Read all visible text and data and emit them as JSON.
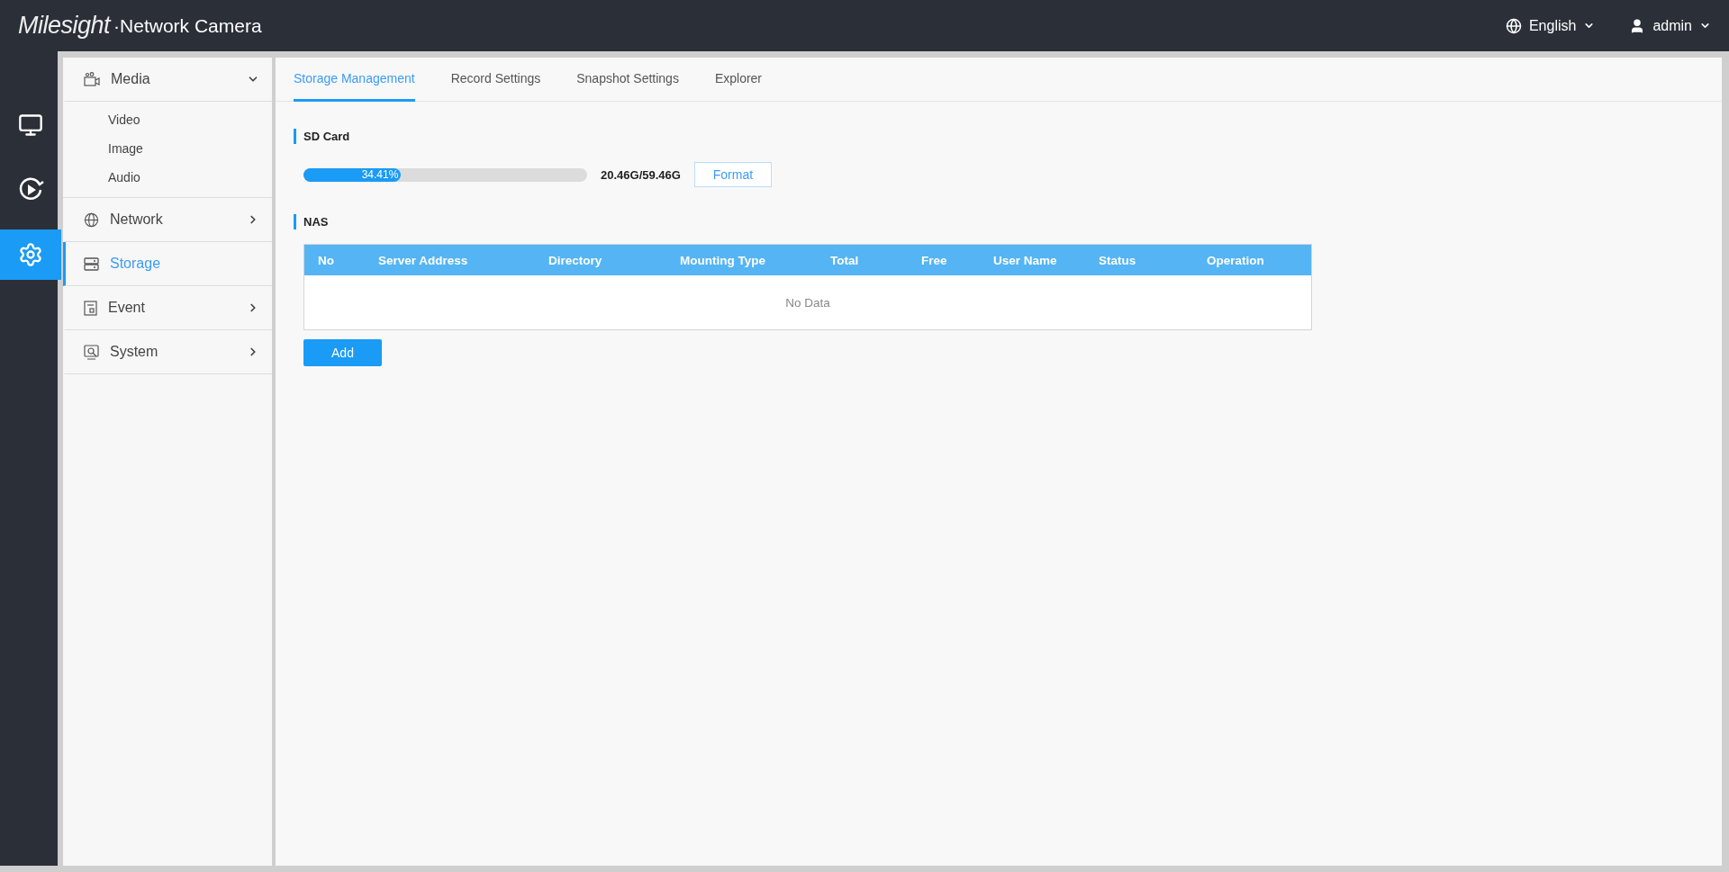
{
  "header": {
    "logo": "Milesight",
    "product": "·Network Camera",
    "language": "English",
    "user": "admin"
  },
  "rail": [
    {
      "kind": "live",
      "selected": false
    },
    {
      "kind": "playback",
      "selected": false
    },
    {
      "kind": "settings",
      "selected": true
    }
  ],
  "sidebar": {
    "items": [
      {
        "label": "Media",
        "kind": "media",
        "expanded": true,
        "selected": false,
        "children": [
          {
            "label": "Video"
          },
          {
            "label": "Image"
          },
          {
            "label": "Audio"
          }
        ]
      },
      {
        "label": "Network",
        "kind": "network",
        "expanded": false,
        "selected": false
      },
      {
        "label": "Storage",
        "kind": "storage",
        "expanded": false,
        "selected": true
      },
      {
        "label": "Event",
        "kind": "event",
        "expanded": false,
        "selected": false
      },
      {
        "label": "System",
        "kind": "system",
        "expanded": false,
        "selected": false
      }
    ]
  },
  "tabs": [
    {
      "label": "Storage Management",
      "selected": true
    },
    {
      "label": "Record Settings",
      "selected": false
    },
    {
      "label": "Snapshot Settings",
      "selected": false
    },
    {
      "label": "Explorer",
      "selected": false
    }
  ],
  "sd_card": {
    "title": "SD Card",
    "level": 0.3441,
    "percent": "34.41%",
    "capacity": "20.46G/59.46G",
    "format_button": "Format"
  },
  "nas": {
    "title": "NAS",
    "table": {
      "columns": [
        "No",
        "Server Address",
        "Directory",
        "Mounting Type",
        "Total",
        "Free",
        "User Name",
        "Status",
        "Operation"
      ],
      "empty_text": "No Data"
    },
    "add_button": "Add"
  }
}
